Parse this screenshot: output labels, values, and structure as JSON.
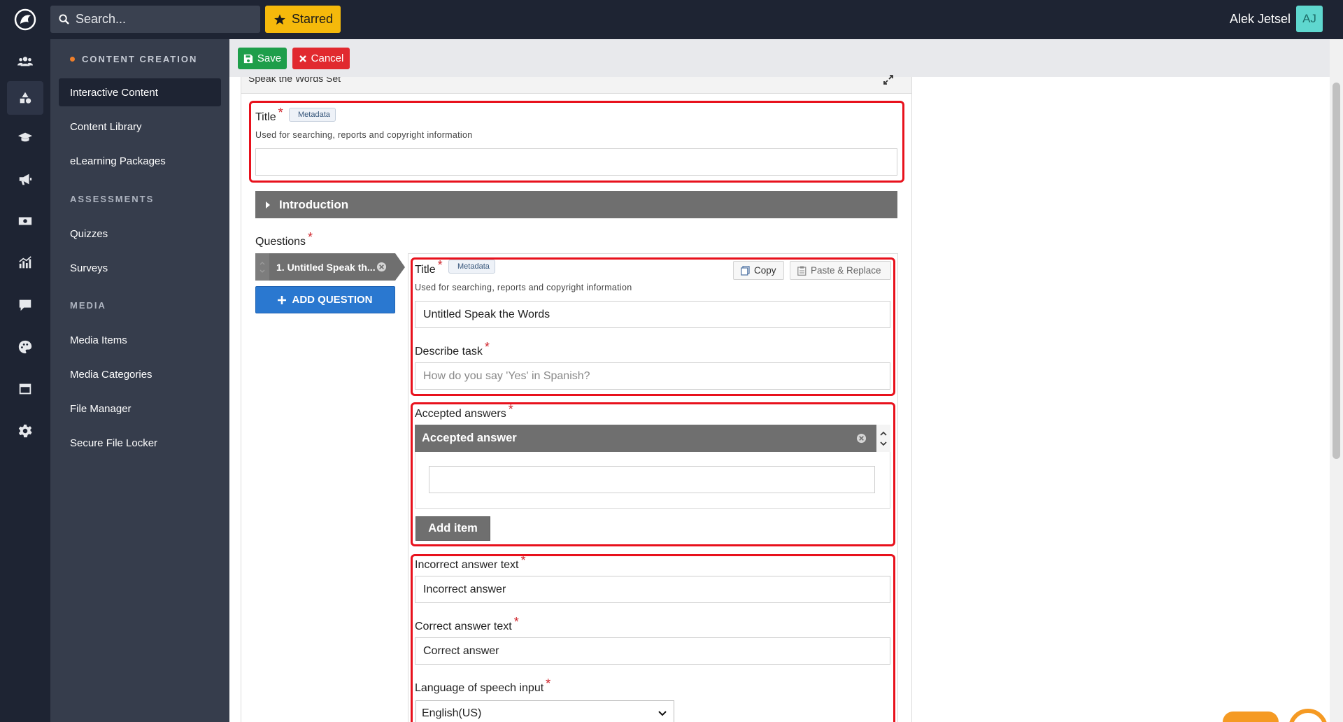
{
  "topbar": {
    "search_placeholder": "Search...",
    "starred_label": "Starred",
    "user_name": "Alek Jetsel",
    "user_initials": "AJ"
  },
  "rail_icons": [
    "users-icon",
    "shapes-icon",
    "graduation-cap-icon",
    "megaphone-icon",
    "money-icon",
    "chart-icon",
    "chat-icon",
    "palette-icon",
    "calendar-icon",
    "gear-icon"
  ],
  "sidebar": {
    "sections": [
      {
        "heading": "CONTENT CREATION",
        "items": [
          "Interactive Content",
          "Content Library",
          "eLearning Packages"
        ]
      },
      {
        "heading": "ASSESSMENTS",
        "items": [
          "Quizzes",
          "Surveys"
        ]
      },
      {
        "heading": "MEDIA",
        "items": [
          "Media Items",
          "Media Categories",
          "File Manager",
          "Secure File Locker"
        ]
      }
    ],
    "active_item": "Interactive Content"
  },
  "actions": {
    "save": "Save",
    "cancel": "Cancel"
  },
  "editor": {
    "panel_title": "Speak the Words Set",
    "title": {
      "label": "Title",
      "metadata_tag": "Metadata",
      "hint": "Used for searching, reports and copyright information",
      "value": ""
    },
    "introduction_label": "Introduction",
    "questions_label": "Questions",
    "question_tab_label": "1. Untitled Speak th...",
    "add_question_label": "ADD QUESTION",
    "question": {
      "title_label": "Title",
      "metadata_tag": "Metadata",
      "copy_label": "Copy",
      "paste_label": "Paste & Replace",
      "hint": "Used for searching, reports and copyright information",
      "title_value": "Untitled Speak the Words",
      "describe_label": "Describe task",
      "describe_placeholder": "How do you say 'Yes' in Spanish?",
      "accepted_label": "Accepted answers",
      "accepted_item_label": "Accepted answer",
      "accepted_value": "",
      "add_item_label": "Add item",
      "incorrect_label": "Incorrect answer text",
      "incorrect_value": "Incorrect answer",
      "correct_label": "Correct answer text",
      "correct_value": "Correct answer",
      "language_label": "Language of speech input",
      "language_value": "English(US)"
    }
  }
}
